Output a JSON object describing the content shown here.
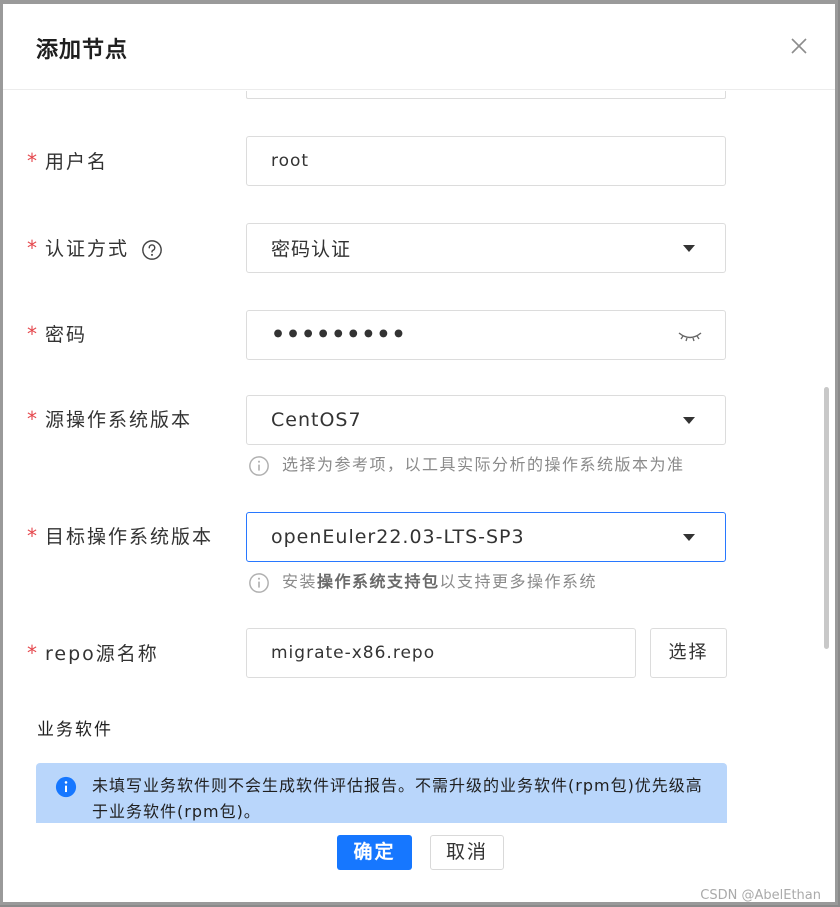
{
  "dialog": {
    "title": "添加节点",
    "close_icon": "close-icon"
  },
  "form": {
    "required_mark": "*",
    "username": {
      "label": "用户名",
      "value": "root"
    },
    "auth": {
      "label": "认证方式",
      "value": "密码认证",
      "help_icon": "question-circle-icon"
    },
    "password": {
      "label": "密码",
      "value": "•••••••••",
      "toggle_icon": "eye-closed-icon"
    },
    "source_os": {
      "label": "源操作系统版本",
      "value": "CentOS7",
      "hint": "选择为参考项，以工具实际分析的操作系统版本为准"
    },
    "target_os": {
      "label": "目标操作系统版本",
      "value": "openEuler22.03-LTS-SP3",
      "hint_prefix": "安装",
      "hint_bold": "操作系统支持包",
      "hint_suffix": "以支持更多操作系统"
    },
    "repo": {
      "label": "repo源名称",
      "value": "migrate-x86.repo",
      "select_label": "选择"
    }
  },
  "business": {
    "section_title": "业务软件",
    "alert_text": "未填写业务软件则不会生成软件评估报告。不需升级的业务软件(rpm包)优先级高于业务软件(rpm包)。"
  },
  "footer": {
    "confirm_label": "确定",
    "cancel_label": "取消"
  },
  "watermark": "CSDN @AbelEthan",
  "colors": {
    "primary": "#1677ff",
    "required": "#e5484d",
    "alert_bg": "#b9d6fb"
  }
}
